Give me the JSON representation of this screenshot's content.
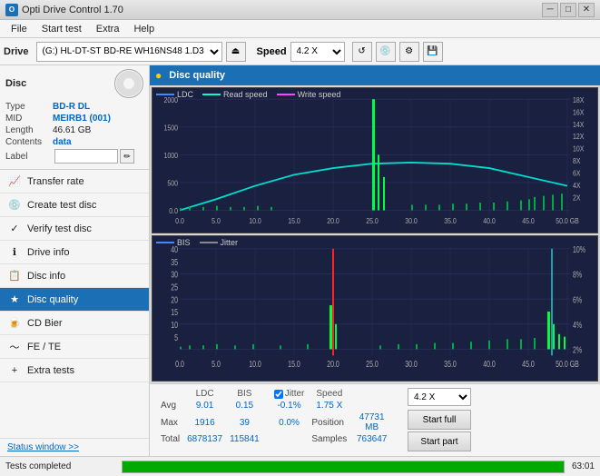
{
  "app": {
    "title": "Opti Drive Control 1.70",
    "icon": "O"
  },
  "titlebar": {
    "minimize": "─",
    "maximize": "□",
    "close": "✕"
  },
  "menubar": {
    "items": [
      "File",
      "Start test",
      "Extra",
      "Help"
    ]
  },
  "drivebar": {
    "label": "Drive",
    "drive_value": "(G:)  HL-DT-ST BD-RE  WH16NS48 1.D3",
    "eject_icon": "⏏",
    "speed_label": "Speed",
    "speed_value": "4.2 X"
  },
  "disc": {
    "section_label": "Disc",
    "type_label": "Type",
    "type_value": "BD-R DL",
    "mid_label": "MID",
    "mid_value": "MEIRB1 (001)",
    "length_label": "Length",
    "length_value": "46.61 GB",
    "contents_label": "Contents",
    "contents_value": "data",
    "label_label": "Label",
    "label_value": "",
    "label_placeholder": ""
  },
  "nav": {
    "items": [
      {
        "id": "transfer-rate",
        "label": "Transfer rate",
        "icon": "📈",
        "active": false
      },
      {
        "id": "create-test-disc",
        "label": "Create test disc",
        "icon": "💿",
        "active": false
      },
      {
        "id": "verify-test-disc",
        "label": "Verify test disc",
        "icon": "✓",
        "active": false
      },
      {
        "id": "drive-info",
        "label": "Drive info",
        "icon": "ℹ",
        "active": false
      },
      {
        "id": "disc-info",
        "label": "Disc info",
        "icon": "📋",
        "active": false
      },
      {
        "id": "disc-quality",
        "label": "Disc quality",
        "icon": "★",
        "active": true
      },
      {
        "id": "cd-bier",
        "label": "CD Bier",
        "icon": "🍺",
        "active": false
      },
      {
        "id": "fe-te",
        "label": "FE / TE",
        "icon": "~",
        "active": false
      },
      {
        "id": "extra-tests",
        "label": "Extra tests",
        "icon": "+",
        "active": false
      }
    ],
    "status_window": "Status window >>"
  },
  "chart1": {
    "title": "Disc quality",
    "legend": {
      "ldc": "LDC",
      "read_speed": "Read speed",
      "write_speed": "Write speed"
    },
    "y_axis_left": [
      "2000",
      "1500",
      "1000",
      "500",
      "0.0"
    ],
    "y_axis_right": [
      "18X",
      "16X",
      "14X",
      "12X",
      "10X",
      "8X",
      "6X",
      "4X",
      "2X"
    ],
    "x_axis": [
      "0.0",
      "5.0",
      "10.0",
      "15.0",
      "20.0",
      "25.0",
      "30.0",
      "35.0",
      "40.0",
      "45.0",
      "50.0 GB"
    ]
  },
  "chart2": {
    "legend": {
      "bis": "BIS",
      "jitter": "Jitter"
    },
    "y_axis_left": [
      "40",
      "35",
      "30",
      "25",
      "20",
      "15",
      "10",
      "5"
    ],
    "y_axis_right": [
      "10%",
      "8%",
      "6%",
      "4%",
      "2%"
    ],
    "x_axis": [
      "0.0",
      "5.0",
      "10.0",
      "15.0",
      "20.0",
      "25.0",
      "30.0",
      "35.0",
      "40.0",
      "45.0",
      "50.0 GB"
    ]
  },
  "stats": {
    "headers": [
      "",
      "LDC",
      "BIS",
      "",
      "Jitter",
      "Speed",
      ""
    ],
    "avg_label": "Avg",
    "avg_ldc": "9.01",
    "avg_bis": "0.15",
    "avg_jitter": "-0.1%",
    "avg_speed": "1.75 X",
    "max_label": "Max",
    "max_ldc": "1916",
    "max_bis": "39",
    "max_jitter": "0.0%",
    "position_label": "Position",
    "position_value": "47731 MB",
    "total_label": "Total",
    "total_ldc": "6878137",
    "total_bis": "115841",
    "samples_label": "Samples",
    "samples_value": "763647",
    "jitter_checked": true,
    "jitter_label": "Jitter",
    "speed_select": "4.2 X",
    "start_full_label": "Start full",
    "start_part_label": "Start part"
  },
  "statusbar": {
    "text": "Tests completed",
    "progress": 100,
    "time": "63:01"
  }
}
